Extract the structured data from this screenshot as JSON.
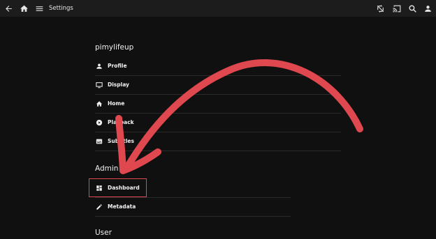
{
  "topbar": {
    "title": "Settings",
    "icons": [
      "back-arrow-icon",
      "home-icon",
      "menu-icon",
      "sync-icon",
      "cast-icon",
      "search-icon",
      "user-icon"
    ]
  },
  "profile_section": {
    "title": "pimylifeup",
    "items": [
      {
        "label": "Profile",
        "icon": "person-icon"
      },
      {
        "label": "Display",
        "icon": "monitor-icon"
      },
      {
        "label": "Home",
        "icon": "home-icon"
      },
      {
        "label": "Playback",
        "icon": "play-icon"
      },
      {
        "label": "Subtitles",
        "icon": "subtitles-icon"
      }
    ]
  },
  "admin_section": {
    "title": "Admin",
    "items": [
      {
        "label": "Dashboard",
        "icon": "dashboard-icon"
      },
      {
        "label": "Metadata",
        "icon": "pencil-icon"
      }
    ]
  },
  "user_section": {
    "title": "User"
  },
  "annotation": {
    "color": "#e0484f"
  }
}
